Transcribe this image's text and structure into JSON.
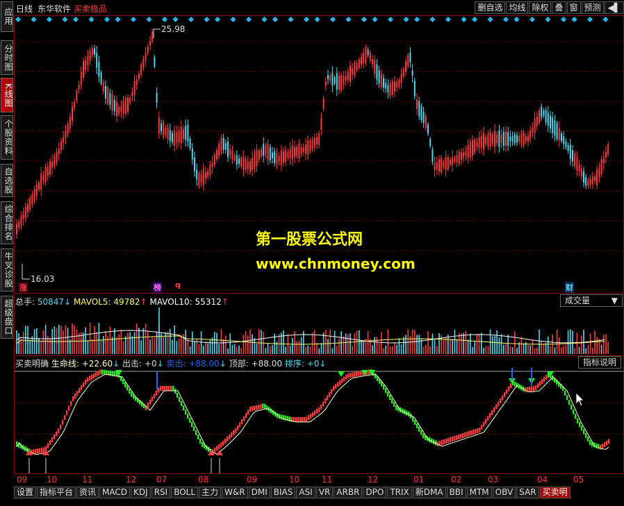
{
  "left_tabs": [
    {
      "label": "应用",
      "active": false
    },
    {
      "label": "分时图",
      "active": false
    },
    {
      "label": "K线图",
      "active": true
    },
    {
      "label": "个股资料",
      "active": false
    },
    {
      "label": "自选股",
      "active": false
    },
    {
      "label": "综合排名",
      "active": false
    },
    {
      "label": "牛叉诊股",
      "active": false
    },
    {
      "label": "超级盘口",
      "active": false
    }
  ],
  "topbar": {
    "period": "日线",
    "software": "东华软件",
    "indicator_name": "买卖极品"
  },
  "top_buttons": [
    "删自选",
    "均线",
    "除权",
    "叠",
    "窗",
    "预测"
  ],
  "price_labels": {
    "high": "25.98",
    "low": "16.03"
  },
  "event_marks": {
    "zhang": "涨",
    "bang": "榜",
    "q": "q",
    "cai": "财"
  },
  "watermark": {
    "line1": "第一股票公式网",
    "line2": "www.chnmoney.com"
  },
  "volume_header": {
    "label": "总手:",
    "value": "50847",
    "arrow1": "↓",
    "ma5_label": "MAVOL5:",
    "ma5_value": "49782",
    "arrow2": "↑",
    "ma10_label": "MAVOL10:",
    "ma10_value": "55312",
    "arrow3": "↑"
  },
  "volume_selector": "成交量",
  "indicator_header": {
    "name": "买卖明确",
    "life_label": "生命线:",
    "life_value": "+22.60",
    "a1": "↓",
    "out_label": "出击:",
    "out_value": "+0",
    "a2": "↓",
    "sell_label": "卖出:",
    "sell_value": "+88.00",
    "a3": "↓",
    "top_label": "顶部:",
    "top_value": "+88.00",
    "order_label": "排序:",
    "order_value": "+0",
    "a4": "↓"
  },
  "indicator_button": "指标说明",
  "months": [
    "09",
    "10",
    "11",
    "12",
    "07",
    "08",
    "09",
    "10",
    "11",
    "12",
    "01",
    "02",
    "03",
    "04",
    "05"
  ],
  "bottom_tabs": [
    {
      "label": "设置",
      "active": false
    },
    {
      "label": "指标平台",
      "active": false
    },
    {
      "label": "资讯",
      "active": false
    },
    {
      "label": "MACD",
      "active": false
    },
    {
      "label": "KDJ",
      "active": false
    },
    {
      "label": "RSI",
      "active": false
    },
    {
      "label": "BOLL",
      "active": false
    },
    {
      "label": "主力",
      "active": false
    },
    {
      "label": "W&R",
      "active": false
    },
    {
      "label": "DMI",
      "active": false
    },
    {
      "label": "BIAS",
      "active": false
    },
    {
      "label": "ASI",
      "active": false
    },
    {
      "label": "VR",
      "active": false
    },
    {
      "label": "ARBR",
      "active": false
    },
    {
      "label": "DPO",
      "active": false
    },
    {
      "label": "TRIX",
      "active": false
    },
    {
      "label": "新DMA",
      "active": false
    },
    {
      "label": "BBI",
      "active": false
    },
    {
      "label": "MTM",
      "active": false
    },
    {
      "label": "OBV",
      "active": false
    },
    {
      "label": "SAR",
      "active": false
    },
    {
      "label": "买卖明",
      "active": true
    }
  ],
  "colors": {
    "up": "#ff3b3b",
    "down": "#54d8f0",
    "sell_green": "#22ee22",
    "life_line": "#ffffcc",
    "diamond": "#29b6e8",
    "grid": "#7a0000",
    "frame": "#8b0000"
  }
}
